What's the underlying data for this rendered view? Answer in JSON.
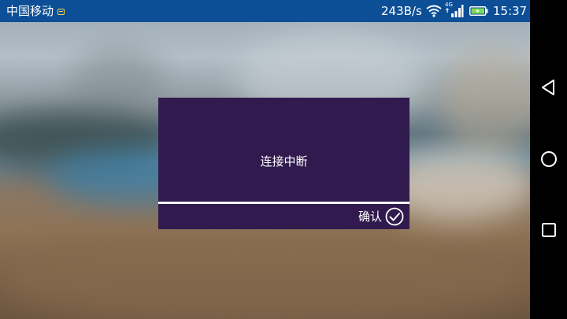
{
  "status_bar": {
    "carrier": "中国移动",
    "net_speed": "243B/s",
    "network_type": "4G",
    "time": "15:37",
    "background_color": "#0d4f96",
    "icons": [
      "sim-icon",
      "wifi-icon",
      "signal-icon",
      "battery-charging-icon"
    ]
  },
  "dialog": {
    "message": "连接中断",
    "confirm_label": "确认",
    "confirm_icon": "check-circle-icon",
    "background_color": "#311a4d"
  },
  "nav_bar": {
    "buttons": [
      "back-icon",
      "home-icon",
      "recent-apps-icon"
    ]
  }
}
